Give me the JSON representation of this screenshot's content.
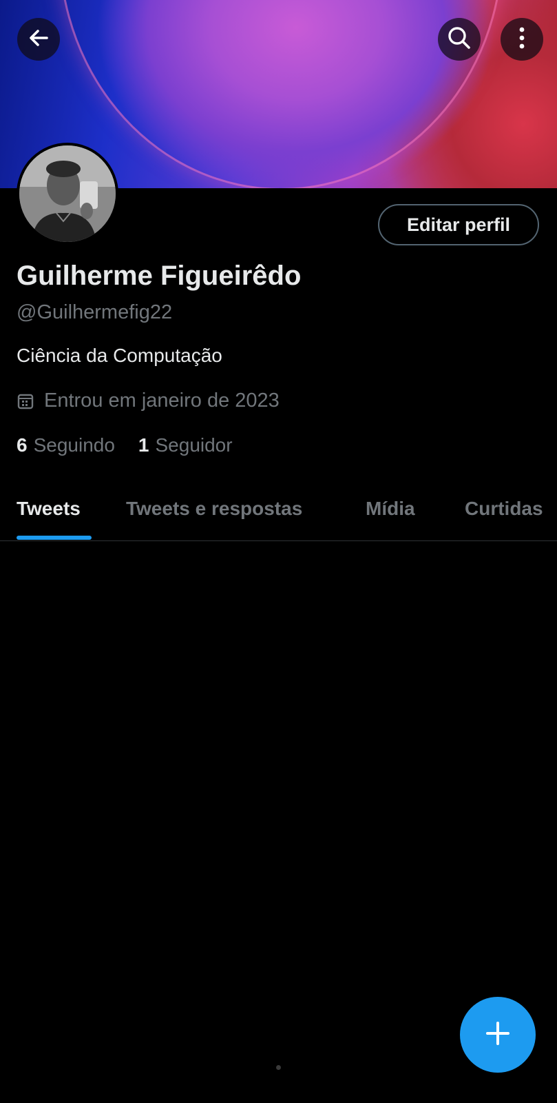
{
  "header": {
    "back_icon": "arrow-left-icon",
    "search_icon": "search-icon",
    "more_icon": "more-vertical-icon"
  },
  "profile": {
    "name": "Guilherme Figueirêdo",
    "handle": "@Guilhermefig22",
    "bio": "Ciência da Computação",
    "joined": "Entrou em janeiro de 2023",
    "following_count": "6",
    "following_label": "Seguindo",
    "followers_count": "1",
    "followers_label": "Seguidor",
    "edit_button_label": "Editar perfil"
  },
  "tabs": [
    {
      "label": "Tweets",
      "active": true
    },
    {
      "label": "Tweets e respostas",
      "active": false
    },
    {
      "label": "Mídia",
      "active": false
    },
    {
      "label": "Curtidas",
      "active": false
    }
  ],
  "fab": {
    "icon": "plus-icon"
  },
  "colors": {
    "accent": "#1d9bf0",
    "background": "#000000",
    "secondary_text": "#71767b"
  }
}
